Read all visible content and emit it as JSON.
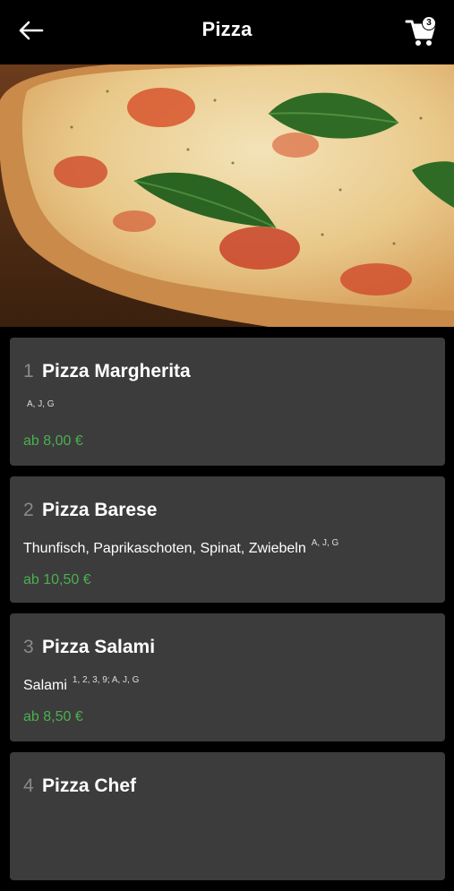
{
  "header": {
    "title": "Pizza",
    "cart_count": "3"
  },
  "colors": {
    "background": "#000000",
    "card": "#3c3c3c",
    "price": "#4caf50",
    "number": "#8a8a8a"
  },
  "hero": {
    "icon": "pizza-photo"
  },
  "items": [
    {
      "number": "1",
      "name": "Pizza Margherita",
      "description": "",
      "allergens": "A, J, G",
      "price": "ab 8,00 €"
    },
    {
      "number": "2",
      "name": "Pizza Barese",
      "description": "Thunfisch, Paprikaschoten, Spinat, Zwiebeln",
      "allergens": "A, J, G",
      "price": "ab 10,50 €"
    },
    {
      "number": "3",
      "name": "Pizza Salami",
      "description": "Salami",
      "allergens": "1, 2, 3, 9; A, J, G",
      "price": "ab 8,50 €"
    },
    {
      "number": "4",
      "name": "Pizza Chef",
      "description": "",
      "allergens": "",
      "price": ""
    }
  ]
}
